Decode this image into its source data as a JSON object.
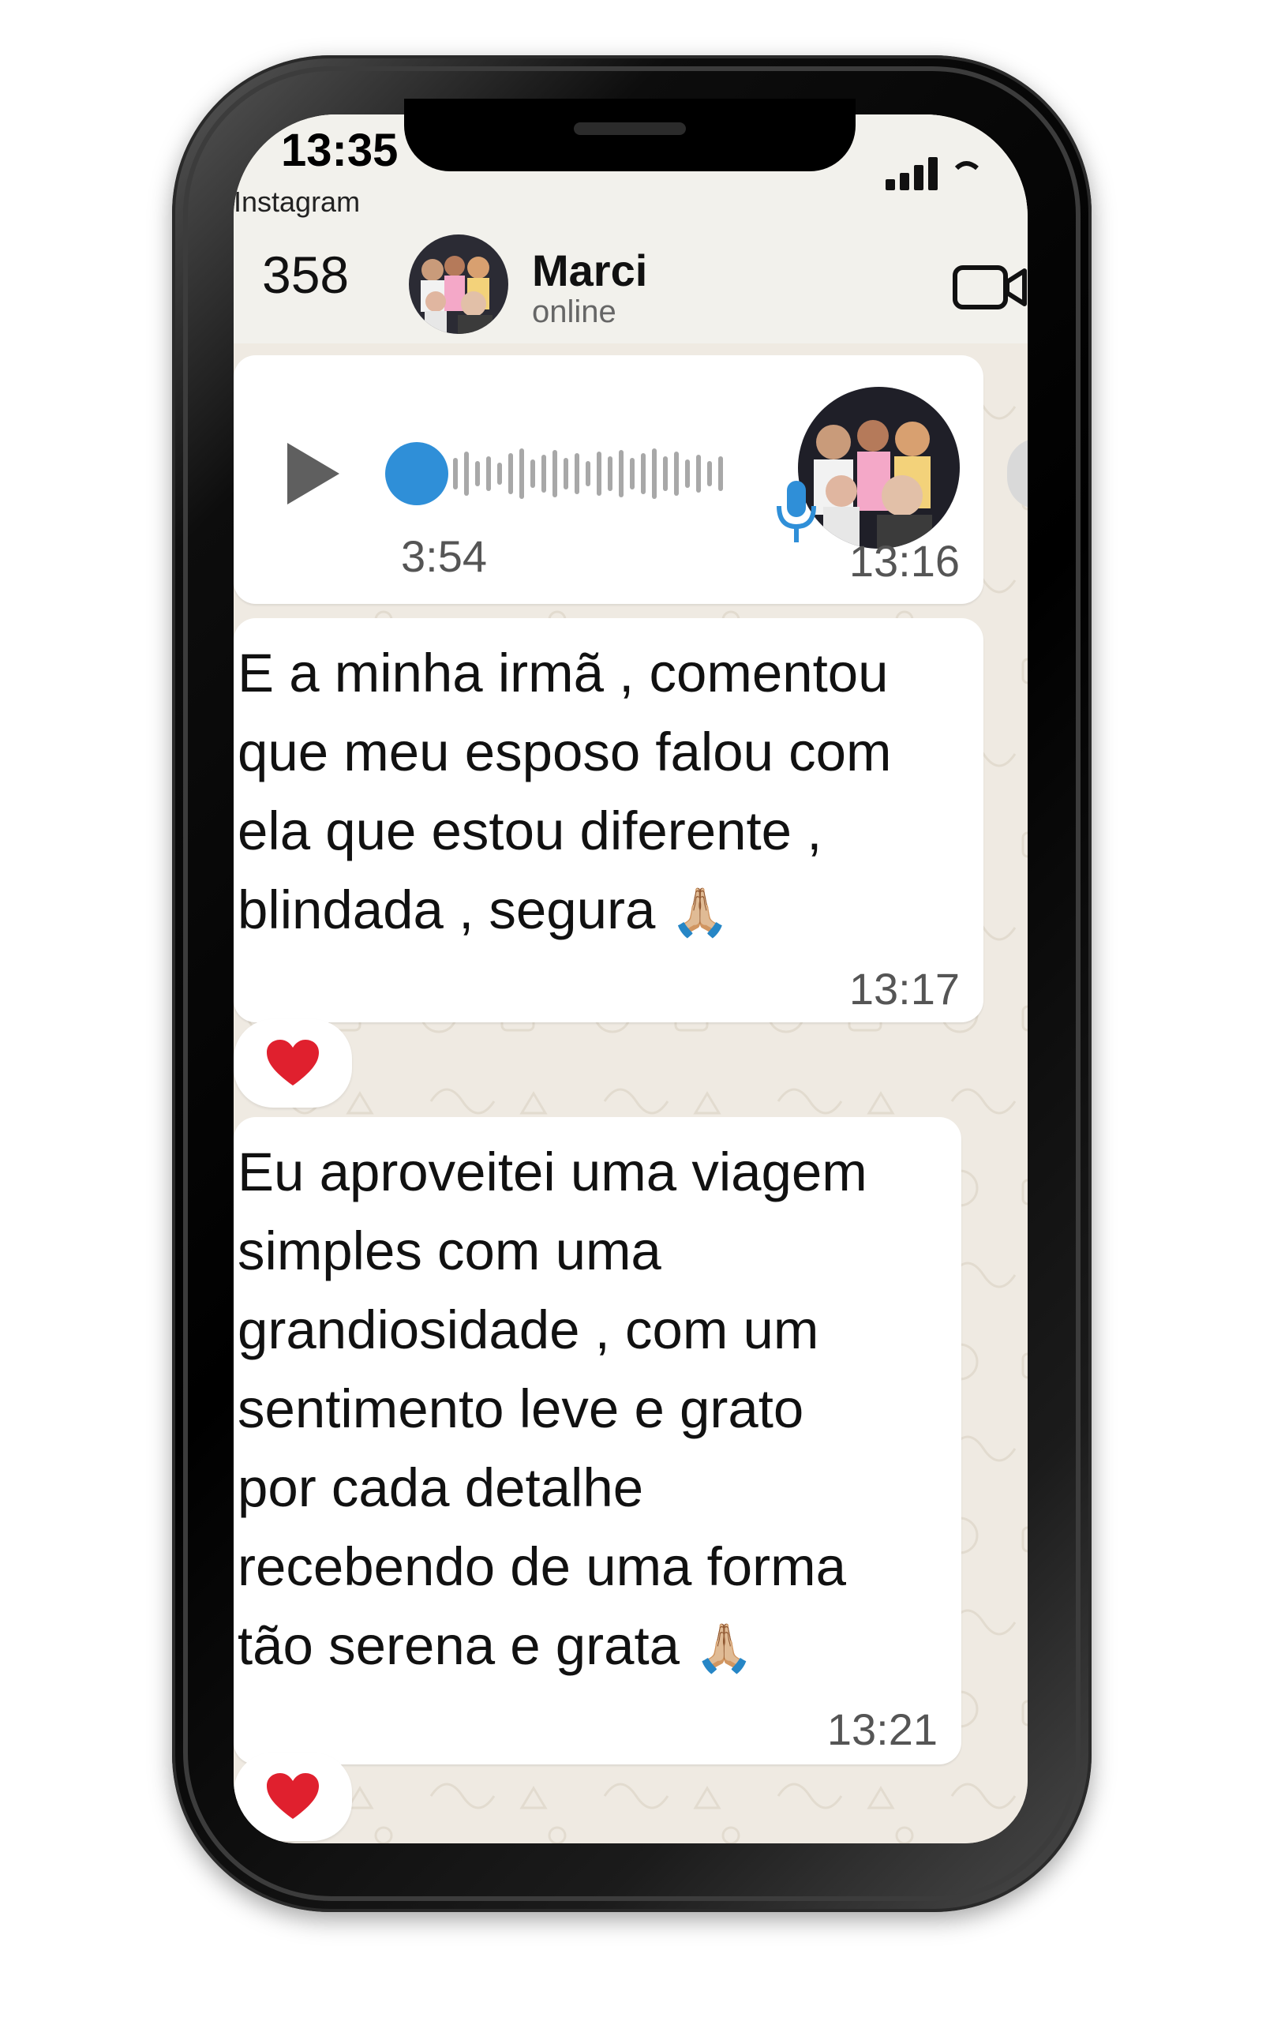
{
  "status_bar": {
    "time": "13:35",
    "back_app": "Instagram"
  },
  "chat_header": {
    "unread_count": "358",
    "contact_name": "Marci",
    "contact_status": "online"
  },
  "messages": [
    {
      "type": "voice",
      "duration": "3:54",
      "time": "13:16"
    },
    {
      "type": "text",
      "text": "E a minha irmã , comentou\nque meu esposo falou com\nela que estou diferente ,\nblindada , segura",
      "emoji": "🙏🏼",
      "time": "13:17",
      "reaction": "❤️"
    },
    {
      "type": "text",
      "text": "Eu aproveitei uma viagem\nsimples com uma\ngrandiosidade , com um\nsentimento leve e grato\npor cada detalhe\nrecebendo de uma forma\ntão serena e grata",
      "emoji": "🙏🏼",
      "time": "13:21",
      "reaction": "❤️"
    }
  ],
  "colors": {
    "chat_bg": "#efeae2",
    "header_bg": "#f2f1ec",
    "bubble": "#ffffff",
    "accent_blue": "#2f8fd8",
    "heart": "#e0202e"
  },
  "icons": [
    "signal-icon",
    "video-call-icon",
    "play-icon",
    "mic-icon",
    "heart-reaction-icon"
  ]
}
